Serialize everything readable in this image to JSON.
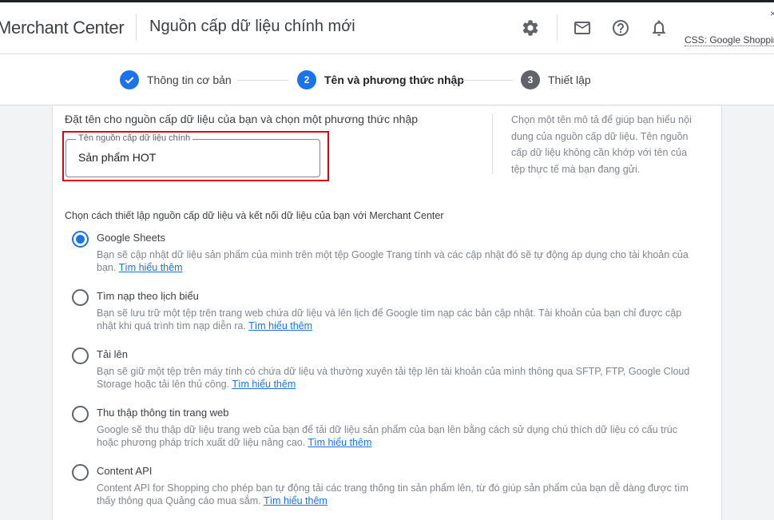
{
  "header": {
    "app_name": "Merchant Center",
    "page_title": "Nguồn cấp dữ liệu chính mới",
    "account": "CSS: Google Shopping",
    "icons": [
      "gear-icon",
      "mail-icon",
      "help-icon",
      "bell-icon"
    ]
  },
  "steps": [
    {
      "number": "✓",
      "label": "Thông tin cơ bản",
      "state": "done"
    },
    {
      "number": "2",
      "label": "Tên và phương thức nhập",
      "state": "active"
    },
    {
      "number": "3",
      "label": "Thiết lập",
      "state": "pending"
    }
  ],
  "name_section": {
    "heading": "Đặt tên cho nguồn cấp dữ liệu của bạn và chọn một phương thức nhập",
    "field_label": "Tên nguồn cấp dữ liệu chính",
    "field_value": "Sản phẩm HOT",
    "help_text": "Chọn một tên mô tả để giúp bạn hiểu nội dung của nguồn cấp dữ liệu. Tên nguồn cấp dữ liệu không cần khớp với tên của tệp thực tế mà bạn đang gửi."
  },
  "method_section": {
    "heading": "Chọn cách thiết lập nguồn cấp dữ liệu và kết nối dữ liệu của bạn với Merchant Center",
    "learn_more": "Tìm hiểu thêm",
    "options": [
      {
        "title": "Google Sheets",
        "selected": true,
        "desc": "Bạn sẽ cập nhật dữ liệu sản phẩm của mình trên một tệp Google Trang tính và các cập nhật đó sẽ tự động áp dụng cho tài khoản của bạn."
      },
      {
        "title": "Tìm nạp theo lịch biểu",
        "selected": false,
        "desc": "Bạn sẽ lưu trữ một tệp trên trang web chứa dữ liệu và lên lịch để Google tìm nạp các bản cập nhật. Tài khoản của bạn chỉ được cập nhật khi quá trình tìm nạp diễn ra."
      },
      {
        "title": "Tải lên",
        "selected": false,
        "desc": "Bạn sẽ giữ một tệp trên máy tính có chứa dữ liệu và thường xuyên tải tệp lên tài khoản của mình thông qua SFTP, FTP, Google Cloud Storage hoặc tải lên thủ công."
      },
      {
        "title": "Thu thập thông tin trang web",
        "selected": false,
        "desc": "Google sẽ thu thập dữ liệu trang web của bạn để tải dữ liệu sản phẩm của bạn lên bằng cách sử dụng chú thích dữ liệu có cấu trúc hoặc phương pháp trích xuất dữ liệu nâng cao."
      },
      {
        "title": "Content API",
        "selected": false,
        "desc": "Content API for Shopping cho phép bạn tự động tải các trang thông tin sản phẩm lên, từ đó giúp sản phẩm của bạn dễ dàng được tìm thấy thông qua Quảng cáo mua sắm."
      }
    ]
  },
  "colors": {
    "accent": "#1a73e8",
    "highlight": "#e0000f",
    "step_pending": "#5f6368"
  }
}
